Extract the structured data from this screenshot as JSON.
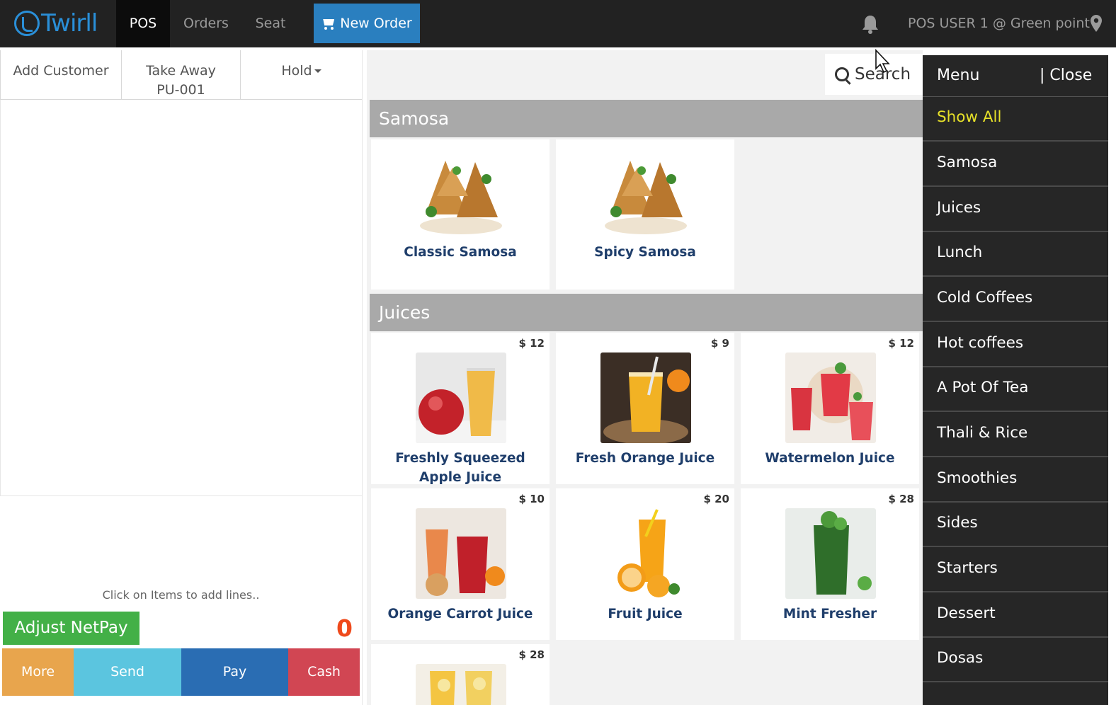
{
  "topbar": {
    "logo_text": "Twirll",
    "nav": [
      {
        "label": "POS",
        "active": true
      },
      {
        "label": "Orders",
        "active": false
      },
      {
        "label": "Seat",
        "active": false
      }
    ],
    "new_order_label": "New Order",
    "bell_icon": "bell-icon",
    "user_label": "POS USER 1 @ Green point",
    "location_icon": "map-pin-icon"
  },
  "order_panel": {
    "add_customer": "Add Customer",
    "take_away": "Take Away",
    "order_code": "PU-001",
    "hold_label": "Hold",
    "hint": "Click on Items to add lines..",
    "adjust_netpay": "Adjust NetPay",
    "total": "0",
    "actions": {
      "more": "More",
      "send": "Send",
      "pay": "Pay",
      "cash": "Cash"
    },
    "colors": {
      "adjust": "#43b047",
      "more": "#e8a54d",
      "send": "#5bc5df",
      "pay": "#2a6db3",
      "cash": "#d14653",
      "total": "#ef4a1c"
    }
  },
  "products": {
    "search_label": "Search",
    "categories": [
      {
        "name": "Samosa",
        "items": [
          {
            "name": "Classic Samosa",
            "price": ""
          },
          {
            "name": "Spicy Samosa",
            "price": ""
          }
        ]
      },
      {
        "name": "Juices",
        "items": [
          {
            "name": "Freshly Squeezed Apple Juice",
            "price": "$ 12"
          },
          {
            "name": "Fresh Orange Juice",
            "price": "$ 9"
          },
          {
            "name": "Watermelon Juice",
            "price": "$ 12"
          },
          {
            "name": "Orange Carrot Juice",
            "price": "$ 10"
          },
          {
            "name": "Fruit Juice",
            "price": "$ 20"
          },
          {
            "name": "Mint Fresher",
            "price": "$ 28"
          },
          {
            "name": "",
            "price": "$ 28"
          }
        ]
      }
    ]
  },
  "menu": {
    "title": "Menu",
    "close_label": "| Close",
    "items": [
      {
        "label": "Show All",
        "active": true
      },
      {
        "label": "Samosa",
        "active": false
      },
      {
        "label": "Juices",
        "active": false
      },
      {
        "label": "Lunch",
        "active": false
      },
      {
        "label": "Cold Coffees",
        "active": false
      },
      {
        "label": "Hot coffees",
        "active": false
      },
      {
        "label": "A Pot Of Tea",
        "active": false
      },
      {
        "label": "Thali & Rice",
        "active": false
      },
      {
        "label": "Smoothies",
        "active": false
      },
      {
        "label": "Sides",
        "active": false
      },
      {
        "label": "Starters",
        "active": false
      },
      {
        "label": "Dessert",
        "active": false
      },
      {
        "label": "Dosas",
        "active": false
      }
    ],
    "active_color": "#e6e029"
  }
}
